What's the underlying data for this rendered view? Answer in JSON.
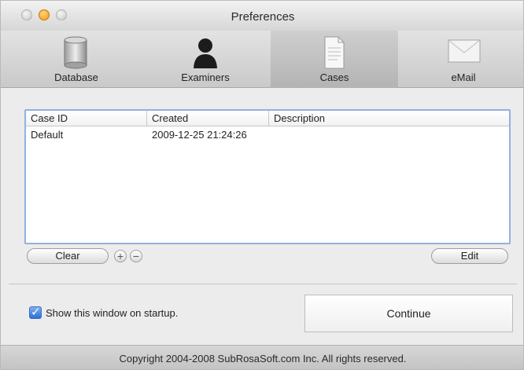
{
  "window": {
    "title": "Preferences"
  },
  "toolbar": {
    "items": [
      {
        "label": "Database",
        "icon": "database-icon",
        "selected": false
      },
      {
        "label": "Examiners",
        "icon": "examiner-icon",
        "selected": false
      },
      {
        "label": "Cases",
        "icon": "document-icon",
        "selected": true
      },
      {
        "label": "eMail",
        "icon": "mail-icon",
        "selected": false
      }
    ]
  },
  "cases_table": {
    "columns": [
      "Case ID",
      "Created",
      "Description"
    ],
    "rows": [
      {
        "case_id": "Default",
        "created": "2009-12-25 21:24:26",
        "description": ""
      }
    ]
  },
  "buttons": {
    "clear": "Clear",
    "add": "+",
    "remove": "−",
    "edit": "Edit",
    "continue": "Continue"
  },
  "startup": {
    "label": "Show this window on startup.",
    "checked": true
  },
  "footer": {
    "copyright": "Copyright 2004-2008 SubRosaSoft.com Inc. All rights reserved."
  },
  "colors": {
    "accent": "#2b6fd6",
    "table_focus_border": "#8fb2de"
  }
}
